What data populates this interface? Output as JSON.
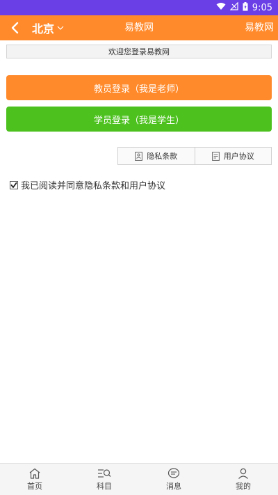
{
  "status_bar": {
    "time": "9:05"
  },
  "header": {
    "city": "北京",
    "title": "易教网",
    "right_link": "易教网"
  },
  "welcome_text": "欢迎您登录易教网",
  "buttons": {
    "teacher_login": "教员登录（我是老师）",
    "student_login": "学员登录（我是学生）"
  },
  "policy": {
    "privacy": "隐私条款",
    "user_agreement": "用户协议"
  },
  "agree": {
    "label": "我已阅读并同意隐私条款和用户协议",
    "checked": true
  },
  "bottom_nav": [
    {
      "label": "首页",
      "icon": "home-icon"
    },
    {
      "label": "科目",
      "icon": "subjects-icon"
    },
    {
      "label": "消息",
      "icon": "message-icon"
    },
    {
      "label": "我的",
      "icon": "profile-icon"
    }
  ],
  "colors": {
    "status_bar": "#6a3fe6",
    "brand_orange": "#ff8a2b",
    "brand_green": "#4dc21f"
  }
}
